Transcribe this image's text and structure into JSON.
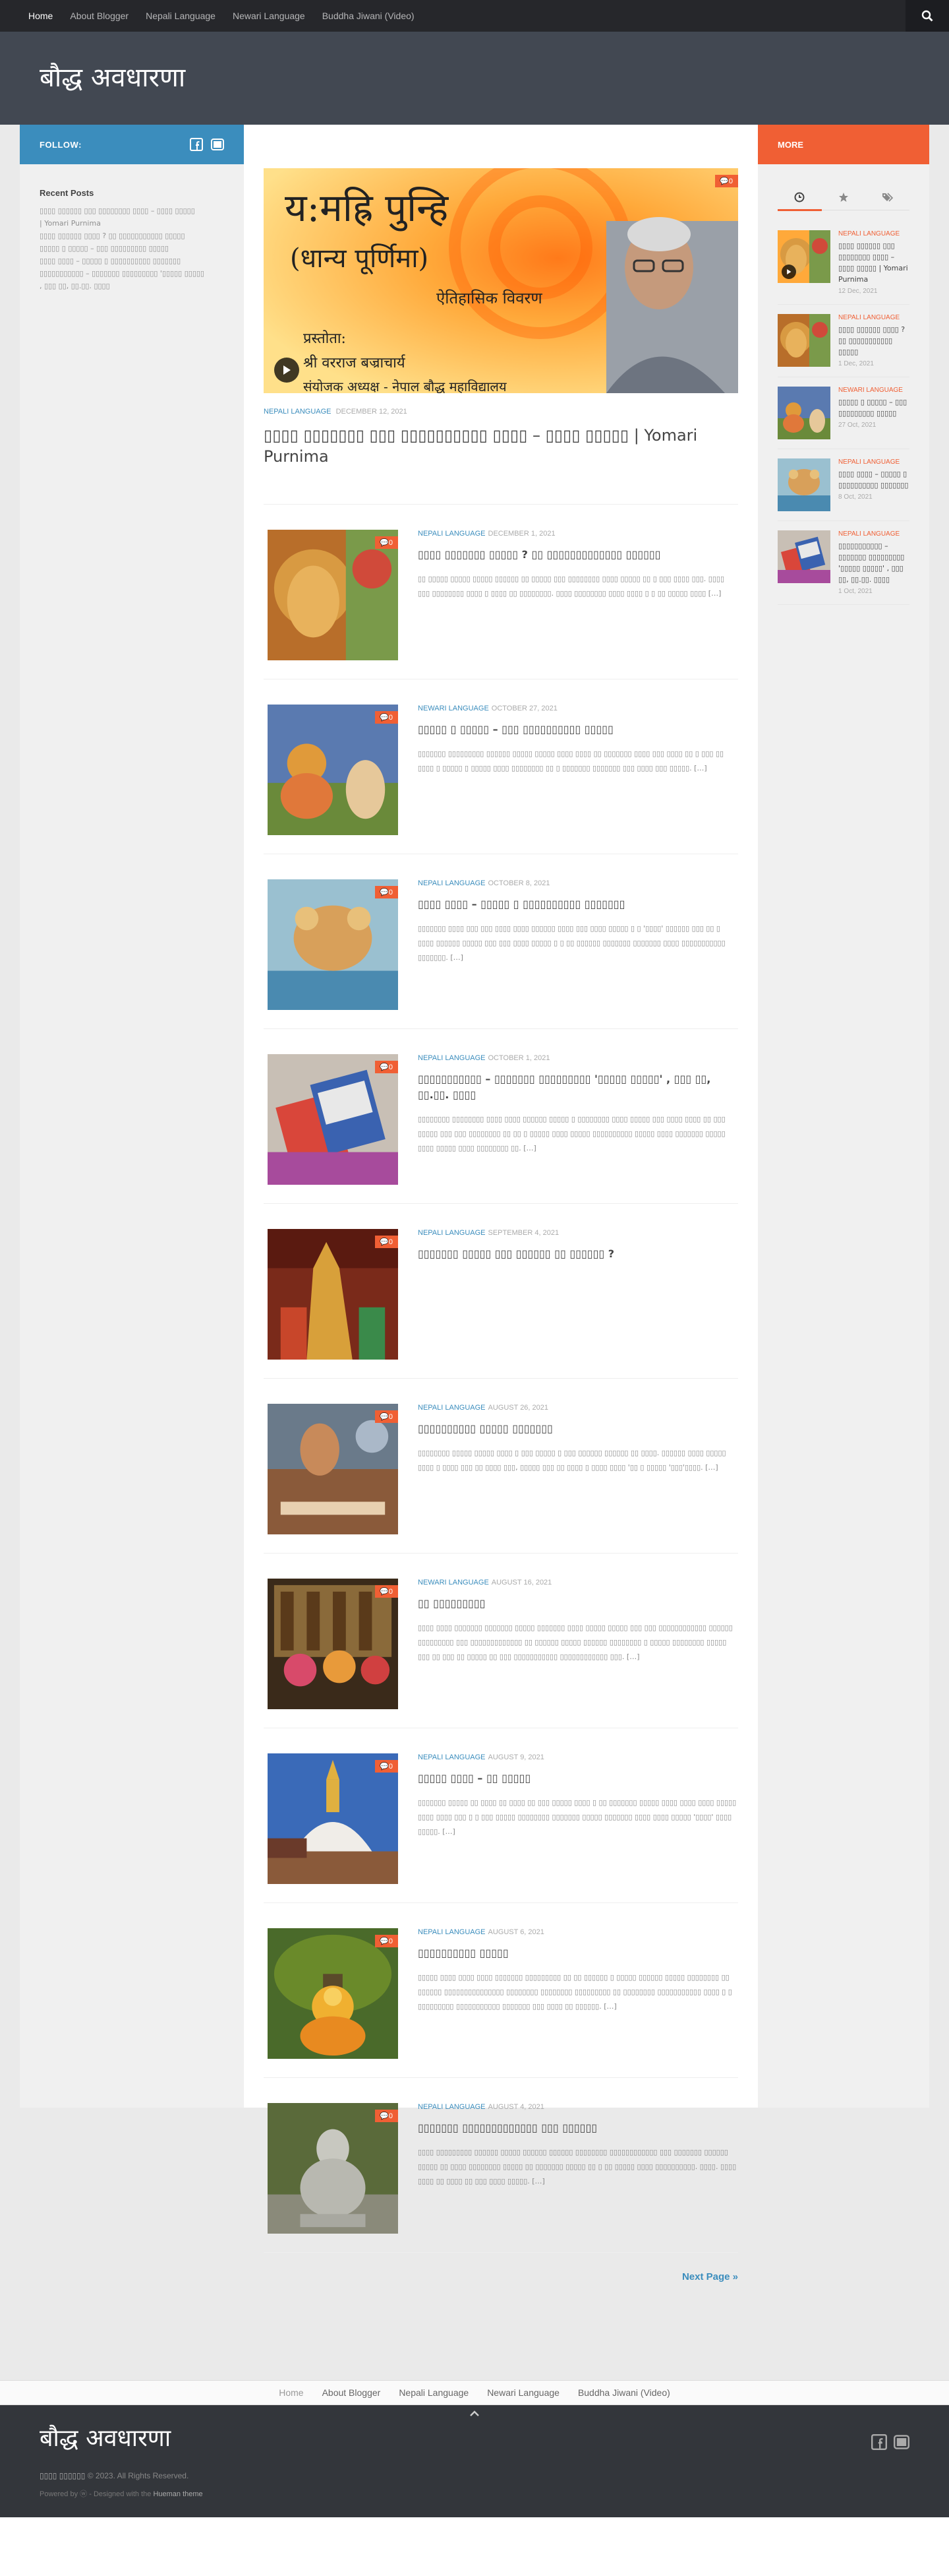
{
  "nav": {
    "items": [
      "Home",
      "About Blogger",
      "Nepali Language",
      "Newari Language",
      "Buddha Jiwani (Video)"
    ],
    "active_index": 0
  },
  "site": {
    "title": "बौद्ध अवधारणा"
  },
  "left_sidebar": {
    "follow_label": "FOLLOW:",
    "recent_title": "Recent Posts",
    "recent_lines": [
      "▯▯▯▯ ▯▯▯▯▯▯ ▯▯▯ ▯▯▯▯▯▯▯▯ ▯▯▯▯ – ▯▯▯▯ ▯▯▯▯▯",
      "| Yomari Purnima",
      "▯▯▯▯ ▯▯▯▯▯▯ ▯▯▯▯ ? ▯▯ ▯▯▯▯▯▯▯▯▯▯▯ ▯▯▯▯▯",
      "▯▯▯▯▯ ▯ ▯▯▯▯▯ – ▯▯▯ ▯▯▯▯▯▯▯▯▯ ▯▯▯▯▯",
      "▯▯▯▯ ▯▯▯▯ – ▯▯▯▯▯ ▯ ▯▯▯▯▯▯▯▯▯▯ ▯▯▯▯▯▯▯",
      "▯▯▯▯▯▯▯▯▯▯▯ – ▯▯▯▯▯▯▯ ▯▯▯▯▯▯▯▯▯ '▯▯▯▯▯ ▯▯▯▯▯",
      ", ▯▯▯ ▯▯, ▯▯.▯▯. ▯▯▯▯"
    ]
  },
  "right_sidebar": {
    "more_label": "MORE",
    "items": [
      {
        "category": "Nepali Language",
        "title": "▯▯▯▯ ▯▯▯▯▯▯ ▯▯▯ ▯▯▯▯▯▯▯▯ ▯▯▯▯ – ▯▯▯▯ ▯▯▯▯▯ | Yomari Purnima",
        "date": "12 Dec, 2021"
      },
      {
        "category": "Nepali Language",
        "title": "▯▯▯▯ ▯▯▯▯▯▯ ▯▯▯▯ ? ▯▯ ▯▯▯▯▯▯▯▯▯▯▯ ▯▯▯▯▯",
        "date": "1 Dec, 2021"
      },
      {
        "category": "Newari Language",
        "title": "▯▯▯▯▯ ▯ ▯▯▯▯▯ – ▯▯▯ ▯▯▯▯▯▯▯▯▯ ▯▯▯▯▯",
        "date": "27 Oct, 2021"
      },
      {
        "category": "Nepali Language",
        "title": "▯▯▯▯ ▯▯▯▯ – ▯▯▯▯▯ ▯ ▯▯▯▯▯▯▯▯▯▯ ▯▯▯▯▯▯▯",
        "date": "8 Oct, 2021"
      },
      {
        "category": "Nepali Language",
        "title": "▯▯▯▯▯▯▯▯▯▯▯ – ▯▯▯▯▯▯▯ ▯▯▯▯▯▯▯▯▯ '▯▯▯▯▯ ▯▯▯▯▯' , ▯▯▯ ▯▯, ▯▯.▯▯. ▯▯▯▯",
        "date": "1 Oct, 2021"
      }
    ]
  },
  "featured": {
    "image_text": {
      "line1": "य:मह्रि पुन्हि",
      "line2": "(धान्य पूर्णिमा)",
      "line3": "ऐतिहासिक विवरण",
      "line4": "प्रस्तोता:",
      "line5": "श्री वरराज बज्राचार्य",
      "line6": "संयोजक अध्यक्ष - नेपाल बौद्ध महाविद्यालय"
    },
    "comments": "0",
    "category": "Nepali Language",
    "date": "December 12, 2021",
    "title": "▯▯▯▯ ▯▯▯▯▯▯▯ ▯▯▯ ▯▯▯▯▯▯▯▯▯▯ ▯▯▯▯ – ▯▯▯▯ ▯▯▯▯▯ | Yomari Purnima"
  },
  "posts": [
    {
      "category": "Nepali Language",
      "date": "December 1, 2021",
      "comments": "0",
      "title": "▯▯▯▯ ▯▯▯▯▯▯▯ ▯▯▯▯▯ ? ▯▯ ▯▯▯▯▯▯▯▯▯▯▯▯▯ ▯▯▯▯▯▯",
      "excerpt": "▯▯ ▯▯▯▯▯ ▯▯▯▯▯ ▯▯▯▯▯ ▯▯▯▯▯▯ ▯▯ ▯▯▯▯▯ ▯▯▯ ▯▯▯▯▯▯▯▯ ▯▯▯▯ ▯▯▯▯▯ ▯▯ ▯ ▯▯▯ ▯▯▯▯ ▯▯▯. ▯▯▯▯ ▯▯▯ ▯▯▯▯▯▯▯▯ ▯▯▯▯ ▯ ▯▯▯▯ ▯▯ ▯▯▯▯▯▯▯▯. ▯▯▯▯ ▯▯▯▯▯▯▯▯ ▯▯▯▯ ▯▯▯▯ ▯ ▯ ▯▯ ▯▯▯▯▯ ▯▯▯▯ […]"
    },
    {
      "category": "Newari Language",
      "date": "October 27, 2021",
      "comments": "0",
      "title": "▯▯▯▯▯ ▯ ▯▯▯▯▯ – ▯▯▯ ▯▯▯▯▯▯▯▯▯▯ ▯▯▯▯▯",
      "excerpt": "▯▯▯▯▯▯▯ ▯▯▯▯▯▯▯▯▯ ▯▯▯▯▯▯ ▯▯▯▯▯ ▯▯▯▯▯ ▯▯▯▯ ▯▯▯▯ ▯▯ ▯▯▯▯▯▯▯ ▯▯▯▯ ▯▯▯ ▯▯▯▯ ▯▯ ▯ ▯▯▯ ▯▯ ▯▯▯▯ ▯ ▯▯▯▯▯ ▯ ▯▯▯▯▯ ▯▯▯▯ ▯▯▯▯▯▯▯▯ ▯▯ ▯ ▯▯▯▯▯▯▯ ▯▯▯▯▯▯▯ ▯▯▯ ▯▯▯▯ ▯▯▯ ▯▯▯▯▯. […]"
    },
    {
      "category": "Nepali Language",
      "date": "October 8, 2021",
      "comments": "0",
      "title": "▯▯▯▯ ▯▯▯▯ – ▯▯▯▯▯ ▯ ▯▯▯▯▯▯▯▯▯▯ ▯▯▯▯▯▯▯",
      "excerpt": "▯▯▯▯▯▯▯ ▯▯▯▯ ▯▯▯ ▯▯▯ ▯▯▯▯ ▯▯▯▯ ▯▯▯▯▯▯ ▯▯▯▯ ▯▯▯ ▯▯▯▯ ▯▯▯▯▯ ▯ ▯ '▯▯▯▯' ▯▯▯▯▯▯ ▯▯▯ ▯▯ ▯ ▯▯▯▯ ▯▯▯▯▯▯ ▯▯▯▯▯ ▯▯▯ ▯▯▯ ▯▯▯▯ ▯▯▯▯▯ ▯ ▯ ▯▯ ▯▯▯▯▯▯ ▯▯▯▯▯▯▯ ▯▯▯▯▯▯▯ ▯▯▯▯ ▯▯▯▯▯▯▯▯▯▯▯ ▯▯▯▯▯▯▯. […]"
    },
    {
      "category": "Nepali Language",
      "date": "October 1, 2021",
      "comments": "0",
      "title": "▯▯▯▯▯▯▯▯▯▯▯ – ▯▯▯▯▯▯▯ ▯▯▯▯▯▯▯▯▯ '▯▯▯▯▯ ▯▯▯▯▯' , ▯▯▯ ▯▯, ▯▯.▯▯. ▯▯▯▯",
      "excerpt": "▯▯▯▯▯▯▯▯ ▯▯▯▯▯▯▯▯ ▯▯▯▯ ▯▯▯▯ ▯▯▯▯▯▯ ▯▯▯▯▯ ▯ ▯▯▯▯▯▯▯▯ ▯▯▯▯ ▯▯▯▯▯ ▯▯▯ ▯▯▯▯ ▯▯▯▯ ▯▯ ▯▯▯ ▯▯▯▯▯ ▯▯▯ ▯▯▯ ▯▯▯▯▯▯▯▯ ▯▯ ▯▯ ▯ ▯▯▯▯▯ ▯▯▯▯ ▯▯▯▯▯ ▯▯▯▯▯▯▯▯▯▯ ▯▯▯▯▯ ▯▯▯▯ ▯▯▯▯▯▯▯ ▯▯▯▯▯ ▯▯▯▯ ▯▯▯▯▯ ▯▯▯▯ ▯▯▯▯▯▯▯▯ ▯▯. […]"
    },
    {
      "category": "Nepali Language",
      "date": "September 4, 2021",
      "comments": "0",
      "title": "▯▯▯▯▯▯▯ ▯▯▯▯▯ ▯▯▯ ▯▯▯▯▯▯ ▯▯ ▯▯▯▯▯▯ ?",
      "excerpt": ""
    },
    {
      "category": "Nepali Language",
      "date": "August 26, 2021",
      "comments": "0",
      "title": "▯▯▯▯▯▯▯▯▯▯ ▯▯▯▯▯ ▯▯▯▯▯▯▯",
      "excerpt": "▯▯▯▯▯▯▯▯ ▯▯▯▯▯ ▯▯▯▯▯ ▯▯▯▯ ▯ ▯▯▯ ▯▯▯▯▯ ▯ ▯▯▯ ▯▯▯▯▯▯ ▯▯▯▯▯▯ ▯▯ ▯▯▯▯. ▯▯▯▯▯▯ ▯▯▯▯ ▯▯▯▯▯ ▯▯▯▯ ▯ ▯▯▯▯ ▯▯▯ ▯▯ ▯▯▯▯ ▯▯▯, ▯▯▯▯▯ ▯▯▯ ▯▯ ▯▯▯▯ ▯ ▯▯▯▯ ▯▯▯▯ '▯▯ ▯ ▯▯▯▯▯ '▯▯▯'▯▯▯▯. […]"
    },
    {
      "category": "Newari Language",
      "date": "August 16, 2021",
      "comments": "0",
      "title": "▯▯ ▯▯▯▯▯▯▯▯▯",
      "excerpt": "▯▯▯▯ ▯▯▯▯ ▯▯▯▯▯▯▯ ▯▯▯▯▯▯▯ ▯▯▯▯▯ ▯▯▯▯▯▯▯ ▯▯▯▯ ▯▯▯▯▯ ▯▯▯▯▯ ▯▯▯ ▯▯▯ ▯▯▯▯▯▯▯▯▯▯▯▯ ▯▯▯▯▯▯ ▯▯▯▯▯▯▯▯▯ ▯▯▯ ▯▯▯▯▯▯▯▯▯▯▯▯▯ ▯▯ ▯▯▯▯▯▯ ▯▯▯▯▯ ▯▯▯▯▯▯ ▯▯▯▯▯▯▯▯ ▯ ▯▯▯▯▯ ▯▯▯▯▯▯▯▯ ▯▯▯▯▯ ▯▯▯ ▯▯ ▯▯▯ ▯▯ ▯▯▯▯▯ ▯▯ ▯▯▯ ▯▯▯▯▯▯▯▯▯▯▯ ▯▯▯▯▯▯▯▯▯▯▯▯ ▯▯▯. […]"
    },
    {
      "category": "Nepali Language",
      "date": "August 9, 2021",
      "comments": "0",
      "title": "▯▯▯▯▯ ▯▯▯▯ – ▯▯ ▯▯▯▯▯",
      "excerpt": "▯▯▯▯▯▯▯ ▯▯▯▯▯ ▯▯ ▯▯▯▯ ▯▯ ▯▯▯▯ ▯▯ ▯▯▯ ▯▯▯▯▯ ▯▯▯▯ ▯ ▯▯ ▯▯▯▯▯▯▯ ▯▯▯▯▯ ▯▯▯▯ ▯▯▯▯ ▯▯▯▯ ▯▯▯▯▯ ▯▯▯▯ ▯▯▯▯ ▯▯▯ ▯ ▯ ▯▯▯ ▯▯▯▯▯ ▯▯▯▯▯▯▯▯ ▯▯▯▯▯▯▯ ▯▯▯▯▯ ▯▯▯▯▯▯▯ ▯▯▯▯ ▯▯▯▯ ▯▯▯▯▯ '▯▯▯▯' ▯▯▯▯ ▯▯▯▯▯. […]"
    },
    {
      "category": "Nepali Language",
      "date": "August 6, 2021",
      "comments": "0",
      "title": "▯▯▯▯▯▯▯▯▯▯ ▯▯▯▯▯",
      "excerpt": "▯▯▯▯▯ ▯▯▯▯ ▯▯▯▯ ▯▯▯▯ ▯▯▯▯▯▯▯ ▯▯▯▯▯▯▯▯▯ ▯▯ ▯▯ ▯▯▯▯▯▯ ▯ ▯▯▯▯▯ ▯▯▯▯▯▯ ▯▯▯▯▯ ▯▯▯▯▯▯▯▯ ▯▯ ▯▯▯▯▯▯ ▯▯▯▯▯▯▯▯▯▯▯▯▯▯▯ ▯▯▯▯▯▯▯▯ ▯▯▯▯▯▯▯▯ ▯▯▯▯▯▯▯▯▯ ▯▯ ▯▯▯▯▯▯▯▯ ▯▯▯▯▯▯▯▯▯▯▯ ▯▯▯▯ ▯ ▯ ▯▯▯▯▯▯▯▯▯ ▯▯▯▯▯▯▯▯▯▯▯ ▯▯▯▯▯▯▯ ▯▯▯ ▯▯▯▯ ▯▯ ▯▯▯▯▯▯. […]"
    },
    {
      "category": "Nepali Language",
      "date": "August 4, 2021",
      "comments": "0",
      "title": "▯▯▯▯▯▯▯ ▯▯▯▯▯▯▯▯▯▯▯▯▯ ▯▯▯ ▯▯▯▯▯▯",
      "excerpt": "▯▯▯▯ ▯▯▯▯▯▯▯▯▯ ▯▯▯▯▯▯ ▯▯▯▯▯ ▯▯▯▯▯▯ ▯▯▯▯▯▯ ▯▯▯▯▯▯▯▯ ▯▯▯▯▯▯▯▯▯▯▯▯ ▯▯▯ ▯▯▯▯▯▯▯ ▯▯▯▯▯▯ ▯▯▯▯▯ ▯▯ ▯▯▯▯ ▯▯▯▯▯▯▯▯ ▯▯▯▯▯ ▯▯ ▯▯▯▯▯▯▯ ▯▯▯▯▯ ▯▯ ▯ ▯▯ ▯▯▯▯▯ ▯▯▯▯ ▯▯▯▯▯▯▯▯▯▯. ▯▯▯▯. ▯▯▯▯ ▯▯▯▯ ▯▯ ▯▯▯▯ ▯▯ ▯▯▯ ▯▯▯▯ ▯▯▯▯▯. […]"
    }
  ],
  "next_page": "Next Page »",
  "footer": {
    "nav": [
      "Home",
      "About Blogger",
      "Nepali Language",
      "Newari Language",
      "Buddha Jiwani (Video)"
    ],
    "site_name": "▯▯▯▯ ▯▯▯▯▯▯",
    "copyright": "© 2023. All Rights Reserved.",
    "credit_prefix": "Powered by",
    "credit_mid": "- Designed with the",
    "theme": "Hueman theme"
  }
}
